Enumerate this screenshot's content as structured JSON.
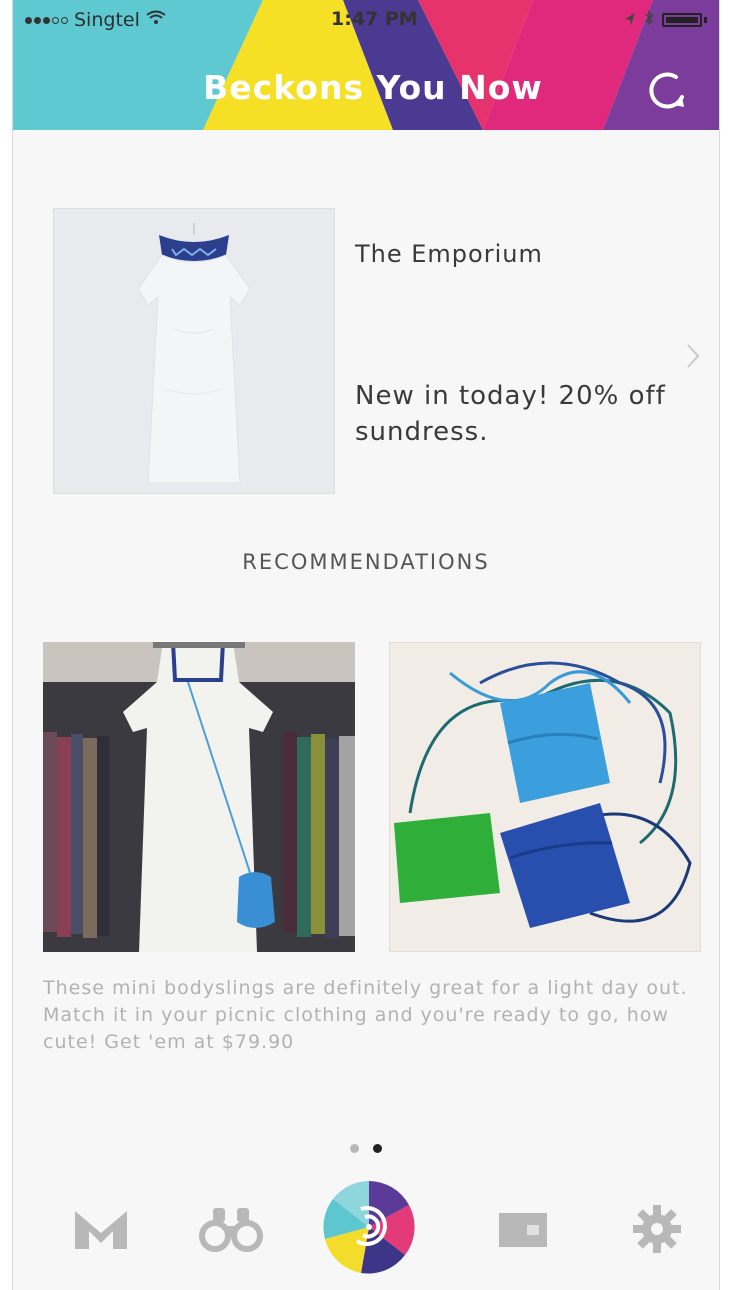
{
  "status_bar": {
    "carrier": "Singtel",
    "time": "1:47 PM"
  },
  "header": {
    "title": "Beckons You Now"
  },
  "featured": {
    "store_name": "The Emporium",
    "offer": "New in today! 20% off sundress."
  },
  "recommendations": {
    "heading": "RECOMMENDATIONS",
    "caption": "These mini bodyslings are definitely great for a light day out. Match it in your picnic clothing and you're ready to go, how cute! Get 'em at $79.90"
  },
  "pagination": {
    "current_page": 2,
    "total_pages": 2
  },
  "tab_bar": {
    "tabs": [
      {
        "icon": "m-logo-icon",
        "active": false
      },
      {
        "icon": "binoculars-icon",
        "active": false
      },
      {
        "icon": "beacon-wheel-icon",
        "active": true
      },
      {
        "icon": "wallet-card-icon",
        "active": false
      },
      {
        "icon": "gear-icon",
        "active": false
      }
    ]
  },
  "colors": {
    "header_teal": "#5fc9d2",
    "header_yellow": "#f5e026",
    "header_purple": "#4b3a91",
    "header_pink": "#e7336d",
    "header_violet": "#7b3c9c",
    "caption_gray": "#b2b2b2"
  }
}
